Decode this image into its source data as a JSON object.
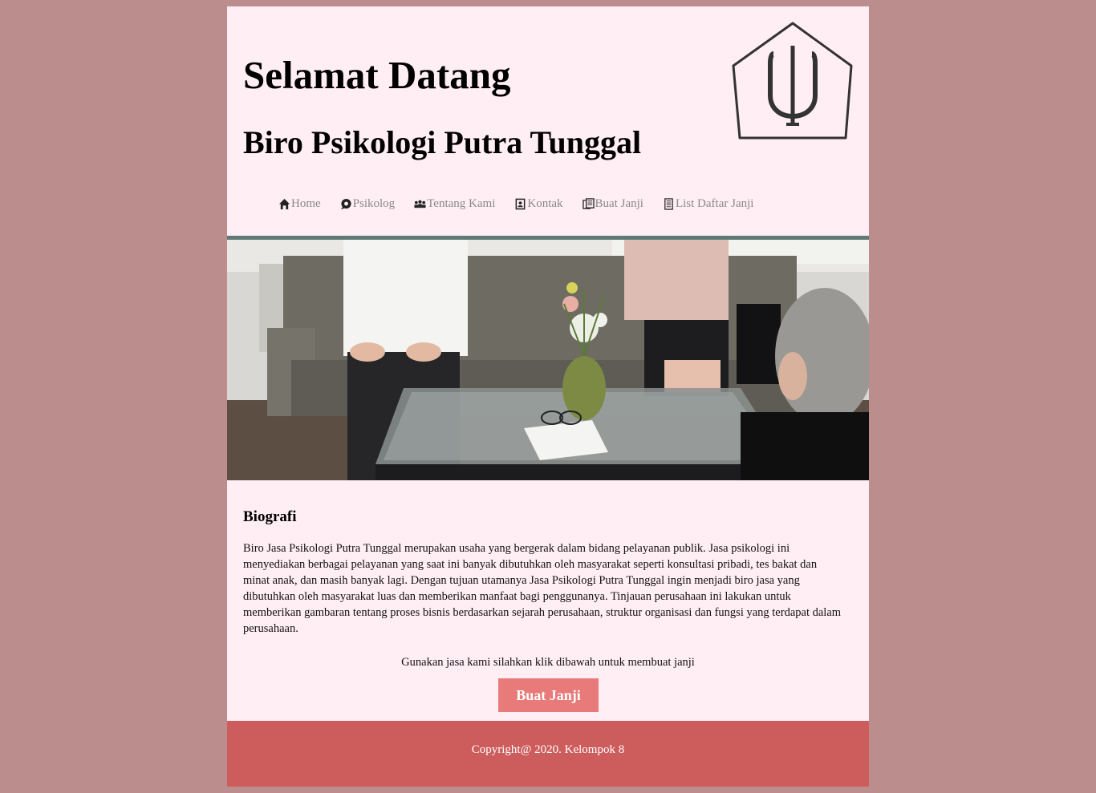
{
  "header": {
    "welcome": "Selamat Datang",
    "bureau_name": "Biro Psikologi Putra Tunggal"
  },
  "nav": {
    "items": [
      {
        "label": "Home",
        "icon": "home-icon"
      },
      {
        "label": "Psikolog",
        "icon": "chat-icon"
      },
      {
        "label": "Tentang Kami",
        "icon": "users-icon"
      },
      {
        "label": "Kontak",
        "icon": "contact-card-icon"
      },
      {
        "label": "Buat Janji",
        "icon": "documents-icon"
      },
      {
        "label": "List Daftar Janji",
        "icon": "document-list-icon"
      }
    ]
  },
  "bio": {
    "title": "Biografi",
    "text": "Biro Jasa Psikologi Putra Tunggal merupakan usaha yang bergerak dalam bidang pelayanan publik. Jasa psikologi ini menyediakan berbagai pelayanan yang saat ini banyak dibutuhkan oleh masyarakat seperti konsultasi pribadi, tes bakat dan minat anak, dan masih banyak lagi. Dengan tujuan utamanya Jasa Psikologi Putra Tunggal ingin menjadi biro jasa yang dibutuhkan oleh masyarakat luas dan memberikan manfaat bagi penggunanya. Tinjauan perusahaan ini lakukan untuk memberikan gambaran tentang proses bisnis berdasarkan sejarah perusahaan, struktur organisasi dan fungsi yang terdapat dalam perusahaan."
  },
  "cta": {
    "text": "Gunakan jasa kami silahkan klik dibawah untuk membuat janji",
    "button_label": "Buat Janji"
  },
  "footer": {
    "copyright": "Copyright@ 2020. Kelompok 8"
  },
  "colors": {
    "page_background": "#bc8d8d",
    "content_background": "#ffeef3",
    "divider": "#5f7a76",
    "button": "#e87a7a",
    "footer": "#cd5c5c"
  }
}
